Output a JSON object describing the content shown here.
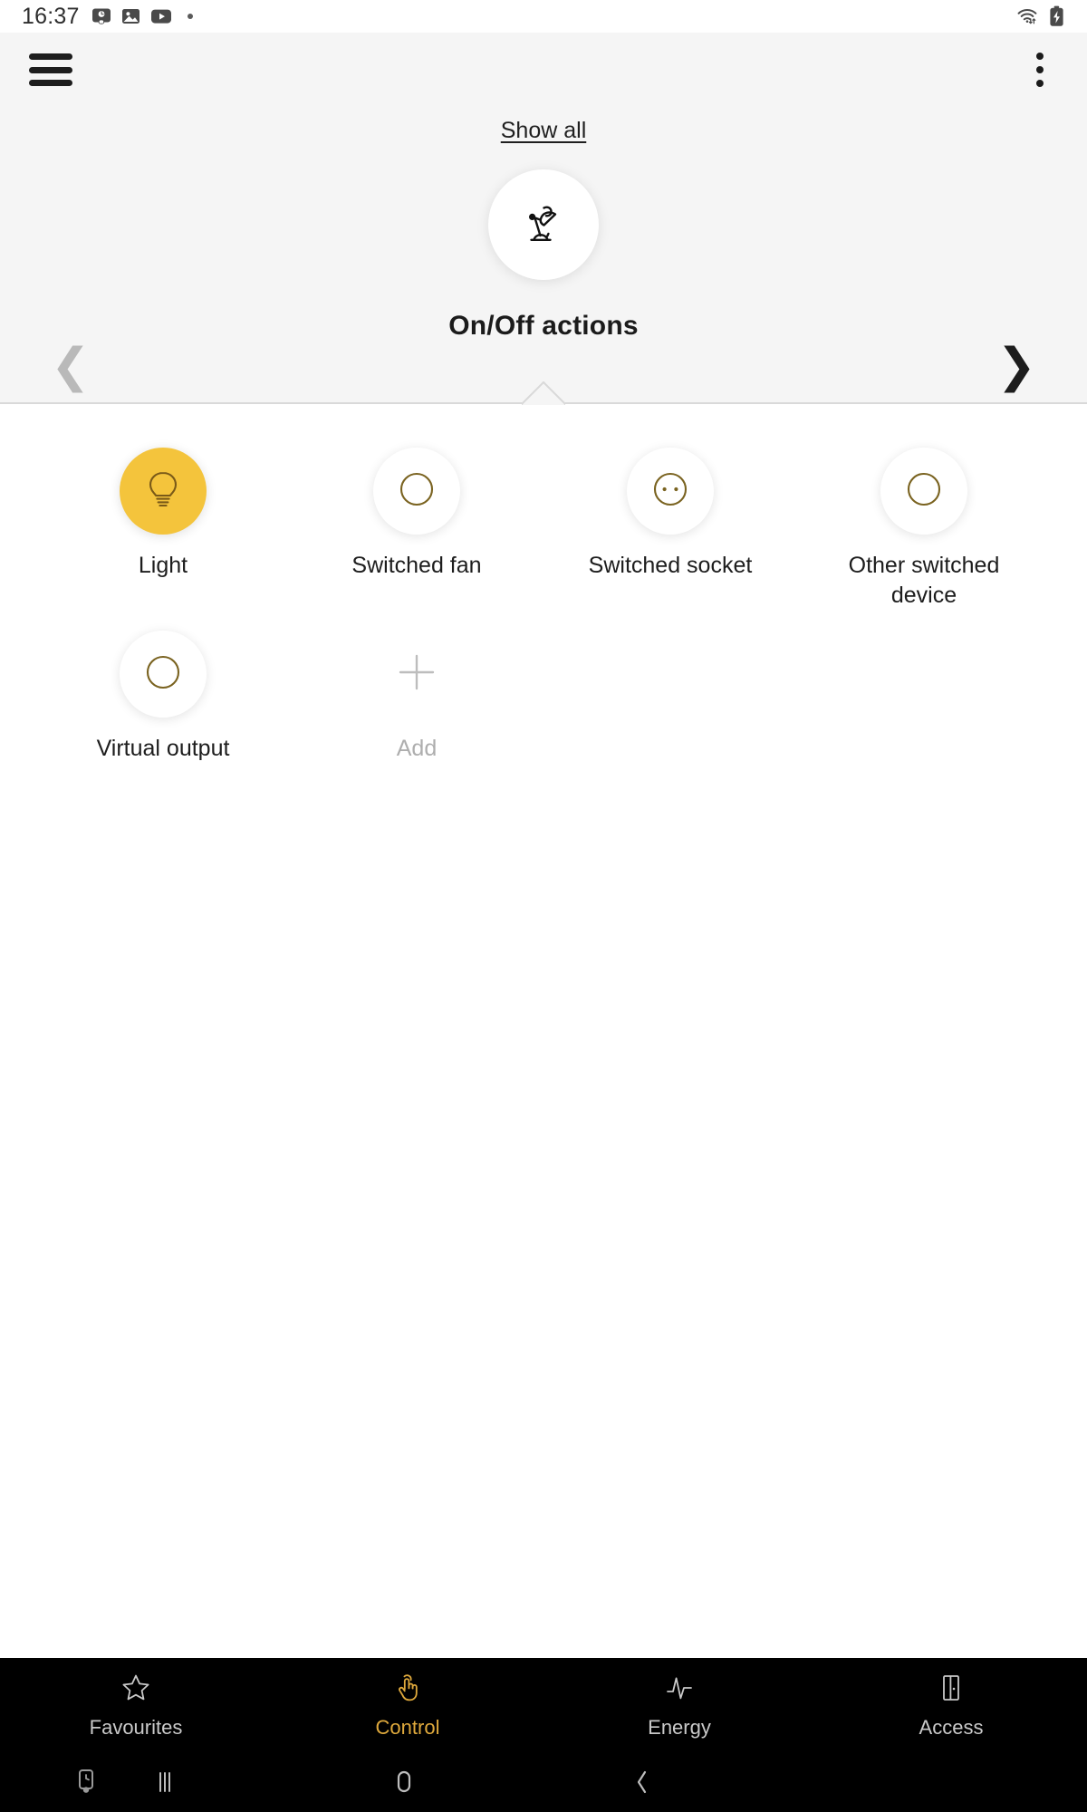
{
  "status_bar": {
    "clock": "16:37",
    "left_icons": [
      "screenshot-icon",
      "gallery-icon",
      "youtube-icon"
    ],
    "notification_dot": "•",
    "right_icons": [
      "wifi-transfer-icon",
      "battery-charging-icon"
    ]
  },
  "toolbar": {
    "menu_icon": "hamburger-menu-icon",
    "overflow_icon": "kebab-menu-icon"
  },
  "top_panel": {
    "show_all_label": "Show all",
    "hero_icon": "desk-lamp-icon",
    "title": "On/Off actions",
    "prev_label": "❮",
    "next_label": "❯",
    "background": "#f5f5f5"
  },
  "devices": [
    {
      "label": "Light",
      "icon": "lightbulb-icon",
      "selected": true,
      "style": "amber"
    },
    {
      "label": "Switched fan",
      "icon": "circle-outline-icon",
      "selected": false,
      "style": "white"
    },
    {
      "label": "Switched socket",
      "icon": "power-socket-icon",
      "selected": false,
      "style": "white"
    },
    {
      "label": "Other switched device",
      "icon": "circle-outline-icon",
      "selected": false,
      "style": "white"
    },
    {
      "label": "Virtual output",
      "icon": "circle-outline-icon",
      "selected": false,
      "style": "white"
    },
    {
      "label": "Add",
      "icon": "plus-icon",
      "selected": false,
      "style": "plain"
    }
  ],
  "bottom_nav": {
    "active": "Control",
    "active_color": "#dfa93c",
    "items": [
      {
        "label": "Favourites",
        "icon": "star-icon"
      },
      {
        "label": "Control",
        "icon": "tap-hand-icon"
      },
      {
        "label": "Energy",
        "icon": "waveform-icon"
      },
      {
        "label": "Access",
        "icon": "door-icon"
      }
    ]
  },
  "system_nav": {
    "items": [
      {
        "icon": "ime-keyboard-icon"
      },
      {
        "icon": "recents-icon"
      },
      {
        "icon": "home-icon"
      },
      {
        "icon": "back-icon"
      }
    ]
  },
  "theme": {
    "accent": "#f4c43c",
    "icon_stroke": "#7a6320",
    "panel_bg": "#f5f5f5",
    "page_bg": "#ffffff",
    "nav_bg": "#000000"
  }
}
